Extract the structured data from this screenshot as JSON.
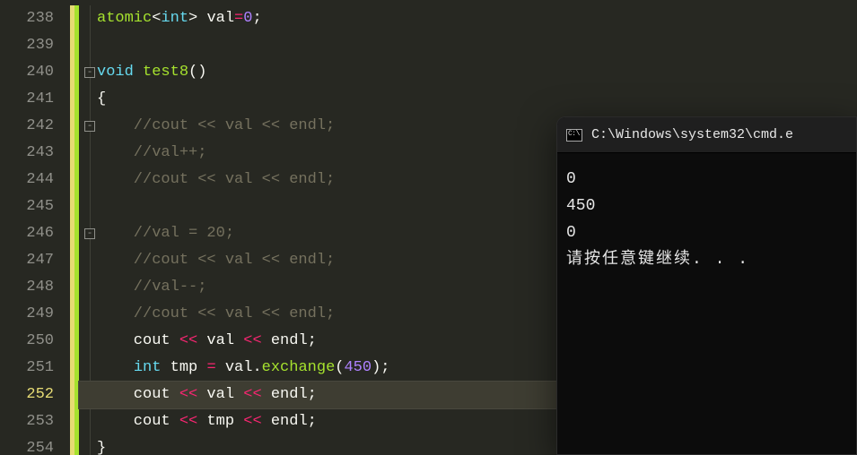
{
  "editor": {
    "lineNumbers": [
      "238",
      "239",
      "240",
      "241",
      "242",
      "243",
      "244",
      "245",
      "246",
      "247",
      "248",
      "249",
      "250",
      "251",
      "252",
      "253",
      "254"
    ],
    "currentLineIndex": 14,
    "lines": [
      {
        "indent": 1,
        "fold": null,
        "tokens": [
          {
            "t": "atomic",
            "c": "type"
          },
          {
            "t": "<",
            "c": "punct"
          },
          {
            "t": "int",
            "c": "kw"
          },
          {
            "t": "> ",
            "c": "punct"
          },
          {
            "t": "val",
            "c": "id"
          },
          {
            "t": "=",
            "c": "op"
          },
          {
            "t": "0",
            "c": "num"
          },
          {
            "t": ";",
            "c": "punct"
          }
        ]
      },
      {
        "indent": 0,
        "fold": null,
        "tokens": []
      },
      {
        "indent": 0,
        "fold": "open",
        "tokens": [
          {
            "t": "void",
            "c": "kw"
          },
          {
            "t": " ",
            "c": "id"
          },
          {
            "t": "test8",
            "c": "fn"
          },
          {
            "t": "()",
            "c": "punct"
          }
        ]
      },
      {
        "indent": 1,
        "fold": null,
        "tokens": [
          {
            "t": "{",
            "c": "punct"
          }
        ]
      },
      {
        "indent": 1,
        "fold": "open",
        "tokens": [
          {
            "t": "    //cout << val << endl;",
            "c": "cmt"
          }
        ]
      },
      {
        "indent": 1,
        "fold": null,
        "tokens": [
          {
            "t": "    //val++;",
            "c": "cmt"
          }
        ]
      },
      {
        "indent": 1,
        "fold": null,
        "tokens": [
          {
            "t": "    //cout << val << endl;",
            "c": "cmt"
          }
        ]
      },
      {
        "indent": 1,
        "fold": null,
        "tokens": []
      },
      {
        "indent": 1,
        "fold": "open",
        "tokens": [
          {
            "t": "    //val = 20;",
            "c": "cmt"
          }
        ]
      },
      {
        "indent": 1,
        "fold": null,
        "tokens": [
          {
            "t": "    //cout << val << endl;",
            "c": "cmt"
          }
        ]
      },
      {
        "indent": 1,
        "fold": null,
        "tokens": [
          {
            "t": "    //val--;",
            "c": "cmt"
          }
        ]
      },
      {
        "indent": 1,
        "fold": null,
        "tokens": [
          {
            "t": "    //cout << val << endl;",
            "c": "cmt"
          }
        ]
      },
      {
        "indent": 1,
        "fold": null,
        "tokens": [
          {
            "t": "    cout ",
            "c": "id"
          },
          {
            "t": "<<",
            "c": "op"
          },
          {
            "t": " val ",
            "c": "id"
          },
          {
            "t": "<<",
            "c": "op"
          },
          {
            "t": " endl",
            "c": "id"
          },
          {
            "t": ";",
            "c": "punct"
          }
        ]
      },
      {
        "indent": 1,
        "fold": null,
        "tokens": [
          {
            "t": "    ",
            "c": "id"
          },
          {
            "t": "int",
            "c": "kw"
          },
          {
            "t": " tmp ",
            "c": "id"
          },
          {
            "t": "=",
            "c": "op"
          },
          {
            "t": " val",
            "c": "id"
          },
          {
            "t": ".",
            "c": "punct"
          },
          {
            "t": "exchange",
            "c": "fn"
          },
          {
            "t": "(",
            "c": "punct"
          },
          {
            "t": "450",
            "c": "num"
          },
          {
            "t": ")",
            "c": "punct"
          },
          {
            "t": ";",
            "c": "punct"
          }
        ]
      },
      {
        "indent": 1,
        "fold": null,
        "tokens": [
          {
            "t": "    cout ",
            "c": "id"
          },
          {
            "t": "<<",
            "c": "op"
          },
          {
            "t": " val ",
            "c": "id"
          },
          {
            "t": "<<",
            "c": "op"
          },
          {
            "t": " endl",
            "c": "id"
          },
          {
            "t": ";",
            "c": "punct"
          }
        ]
      },
      {
        "indent": 1,
        "fold": null,
        "tokens": [
          {
            "t": "    cout ",
            "c": "id"
          },
          {
            "t": "<<",
            "c": "op"
          },
          {
            "t": " tmp ",
            "c": "id"
          },
          {
            "t": "<<",
            "c": "op"
          },
          {
            "t": " endl",
            "c": "id"
          },
          {
            "t": ";",
            "c": "punct"
          }
        ]
      },
      {
        "indent": 1,
        "fold": null,
        "tokens": [
          {
            "t": "}",
            "c": "punct"
          }
        ]
      }
    ],
    "changeBars": [
      "yg",
      "yg",
      "yg",
      "yg",
      "yg",
      "yg",
      "yg",
      "yg",
      "yg",
      "yg",
      "yg",
      "yg",
      "yg",
      "yg",
      "yg",
      "yg",
      "yg"
    ]
  },
  "console": {
    "title": "C:\\Windows\\system32\\cmd.e",
    "icon": "cmd-icon",
    "output": [
      "0",
      "450",
      "0",
      "请按任意键继续. . ."
    ]
  }
}
